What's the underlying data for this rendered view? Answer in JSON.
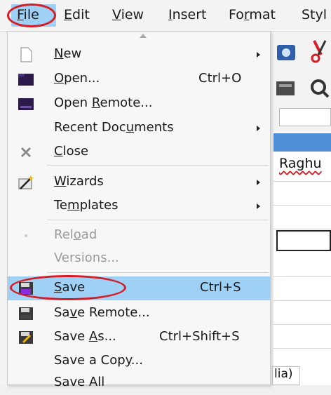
{
  "menubar": {
    "items": [
      {
        "label": "File",
        "key": "F",
        "rest": "ile"
      },
      {
        "label": "Edit",
        "key": "E",
        "rest": "dit"
      },
      {
        "label": "View",
        "key": "V",
        "rest": "iew"
      },
      {
        "label": "Insert",
        "key": "I",
        "rest": "nsert"
      },
      {
        "pre": "Fo",
        "key": "r",
        "rest": "mat",
        "label": "Format"
      },
      {
        "label": "Styl"
      }
    ]
  },
  "file_menu": {
    "new": {
      "pre": "",
      "key": "N",
      "rest": "ew"
    },
    "open": {
      "pre": "",
      "key": "O",
      "rest": "pen...",
      "shortcut": "Ctrl+O"
    },
    "open_remote": {
      "pre": "Open ",
      "key": "R",
      "rest": "emote..."
    },
    "recent": {
      "pre": "Recent Doc",
      "key": "u",
      "rest": "ments"
    },
    "close": {
      "pre": "",
      "key": "C",
      "rest": "lose"
    },
    "wizards": {
      "pre": "",
      "key": "W",
      "rest": "izards"
    },
    "templates": {
      "pre": "Te",
      "key": "m",
      "rest": "plates"
    },
    "reload": {
      "pre": "Rel",
      "key": "o",
      "rest": "ad"
    },
    "versions": {
      "pre": "Versions..."
    },
    "save": {
      "pre": "",
      "key": "S",
      "rest": "ave",
      "shortcut": "Ctrl+S"
    },
    "save_remote": {
      "pre": "Sa",
      "key": "v",
      "rest": "e Remote..."
    },
    "save_as": {
      "pre": "Save ",
      "key": "A",
      "rest": "s...",
      "shortcut": "Ctrl+Shift+S"
    },
    "save_copy": {
      "pre": "Save a Cop",
      "key": "y",
      "rest": "..."
    },
    "save_all": {
      "pre": "Save All"
    }
  },
  "sheet": {
    "cell_text": "Raghu",
    "bottom_tab": "lia)"
  },
  "colors": {
    "highlight": "#9fd0f5",
    "annotation_ring": "#d61c24"
  }
}
